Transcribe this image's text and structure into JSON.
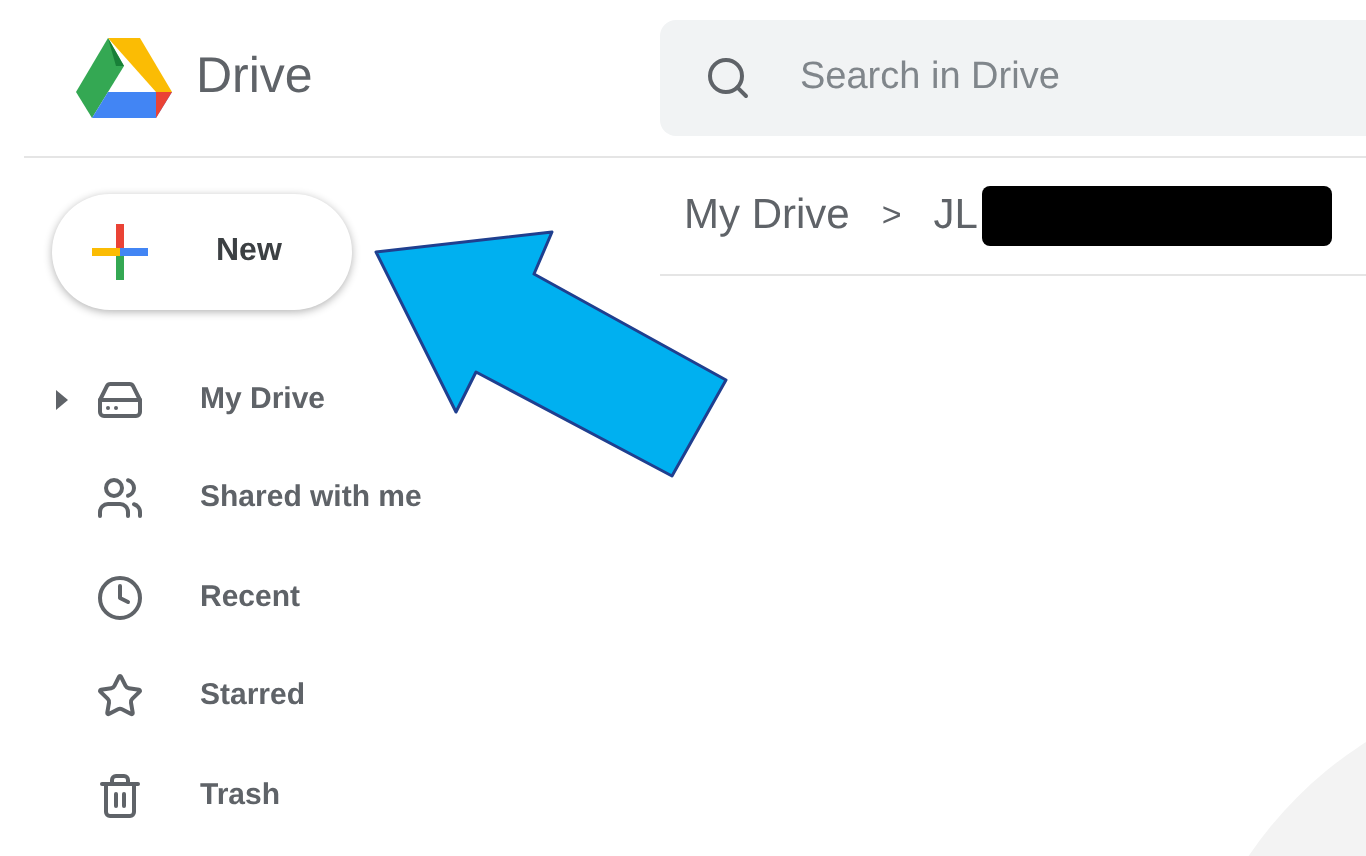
{
  "app": {
    "name": "Drive"
  },
  "search": {
    "placeholder": "Search in Drive"
  },
  "new_button": {
    "label": "New"
  },
  "sidebar": {
    "items": [
      {
        "label": "My Drive",
        "kind": "drive",
        "expandable": true
      },
      {
        "label": "Shared with me",
        "kind": "shared",
        "expandable": false
      },
      {
        "label": "Recent",
        "kind": "recent",
        "expandable": false
      },
      {
        "label": "Starred",
        "kind": "starred",
        "expandable": false
      },
      {
        "label": "Trash",
        "kind": "trash",
        "expandable": false
      }
    ]
  },
  "breadcrumb": {
    "items": [
      "My Drive",
      "JL"
    ],
    "separator": ">"
  }
}
